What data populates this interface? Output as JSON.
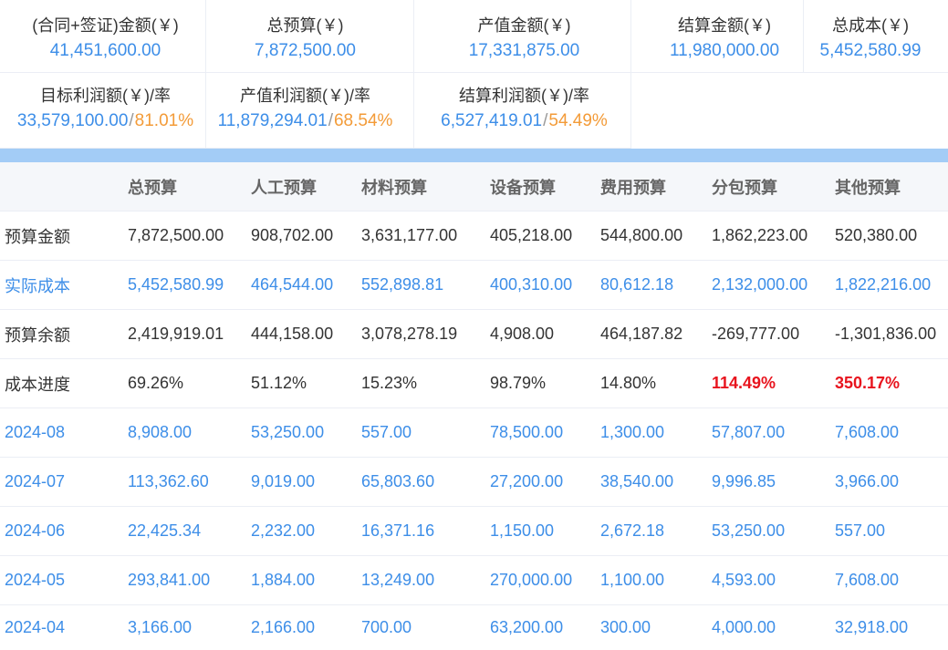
{
  "colors": {
    "link_blue": "#3d8ee8",
    "rate_orange": "#f39b38",
    "alert_red": "#e8141e",
    "text_dark": "#333333",
    "header_text": "#666666",
    "header_bg": "#f5f7fa",
    "accent_bar": "#a3ccf6",
    "divider": "#ebeef5",
    "separator_gray": "#999999"
  },
  "summary": {
    "row1": [
      {
        "label": "(合同+签证)金额(￥)",
        "value": "41,451,600.00"
      },
      {
        "label": "总预算(￥)",
        "value": "7,872,500.00"
      },
      {
        "label": "产值金额(￥)",
        "value": "17,331,875.00"
      },
      {
        "label": "结算金额(￥)",
        "value": "11,980,000.00"
      },
      {
        "label": "总成本(￥)",
        "value": "5,452,580.99"
      }
    ],
    "row2": [
      {
        "label": "目标利润额(￥)/率",
        "amount": "33,579,100.00",
        "separator": "/",
        "rate": "81.01%"
      },
      {
        "label": "产值利润额(￥)/率",
        "amount": "11,879,294.01",
        "separator": "/",
        "rate": "68.54%"
      },
      {
        "label": "结算利润额(￥)/率",
        "amount": "6,527,419.01",
        "separator": "/",
        "rate": "54.49%"
      }
    ]
  },
  "table": {
    "headers": [
      "总预算",
      "人工预算",
      "材料预算",
      "设备预算",
      "费用预算",
      "分包预算",
      "其他预算"
    ],
    "rows": [
      {
        "label": "预算金额",
        "cells": [
          "7,872,500.00",
          "908,702.00",
          "3,631,177.00",
          "405,218.00",
          "544,800.00",
          "1,862,223.00",
          "520,380.00"
        ]
      },
      {
        "label": "实际成本",
        "cells": [
          "5,452,580.99",
          "464,544.00",
          "552,898.81",
          "400,310.00",
          "80,612.18",
          "2,132,000.00",
          "1,822,216.00"
        ]
      },
      {
        "label": "预算余额",
        "cells": [
          "2,419,919.01",
          "444,158.00",
          "3,078,278.19",
          "4,908.00",
          "464,187.82",
          "-269,777.00",
          "-1,301,836.00"
        ]
      },
      {
        "label": "成本进度",
        "cells": [
          "69.26%",
          "51.12%",
          "15.23%",
          "98.79%",
          "14.80%",
          "114.49%",
          "350.17%"
        ]
      },
      {
        "label": "2024-08",
        "cells": [
          "8,908.00",
          "53,250.00",
          "557.00",
          "78,500.00",
          "1,300.00",
          "57,807.00",
          "7,608.00"
        ]
      },
      {
        "label": "2024-07",
        "cells": [
          "113,362.60",
          "9,019.00",
          "65,803.60",
          "27,200.00",
          "38,540.00",
          "9,996.85",
          "3,966.00"
        ]
      },
      {
        "label": "2024-06",
        "cells": [
          "22,425.34",
          "2,232.00",
          "16,371.16",
          "1,150.00",
          "2,672.18",
          "53,250.00",
          "557.00"
        ]
      },
      {
        "label": "2024-05",
        "cells": [
          "293,841.00",
          "1,884.00",
          "13,249.00",
          "270,000.00",
          "1,100.00",
          "4,593.00",
          "7,608.00"
        ]
      },
      {
        "label": "2024-04",
        "cells": [
          "3,166.00",
          "2,166.00",
          "700.00",
          "63,200.00",
          "300.00",
          "4,000.00",
          "32,918.00"
        ]
      }
    ]
  }
}
